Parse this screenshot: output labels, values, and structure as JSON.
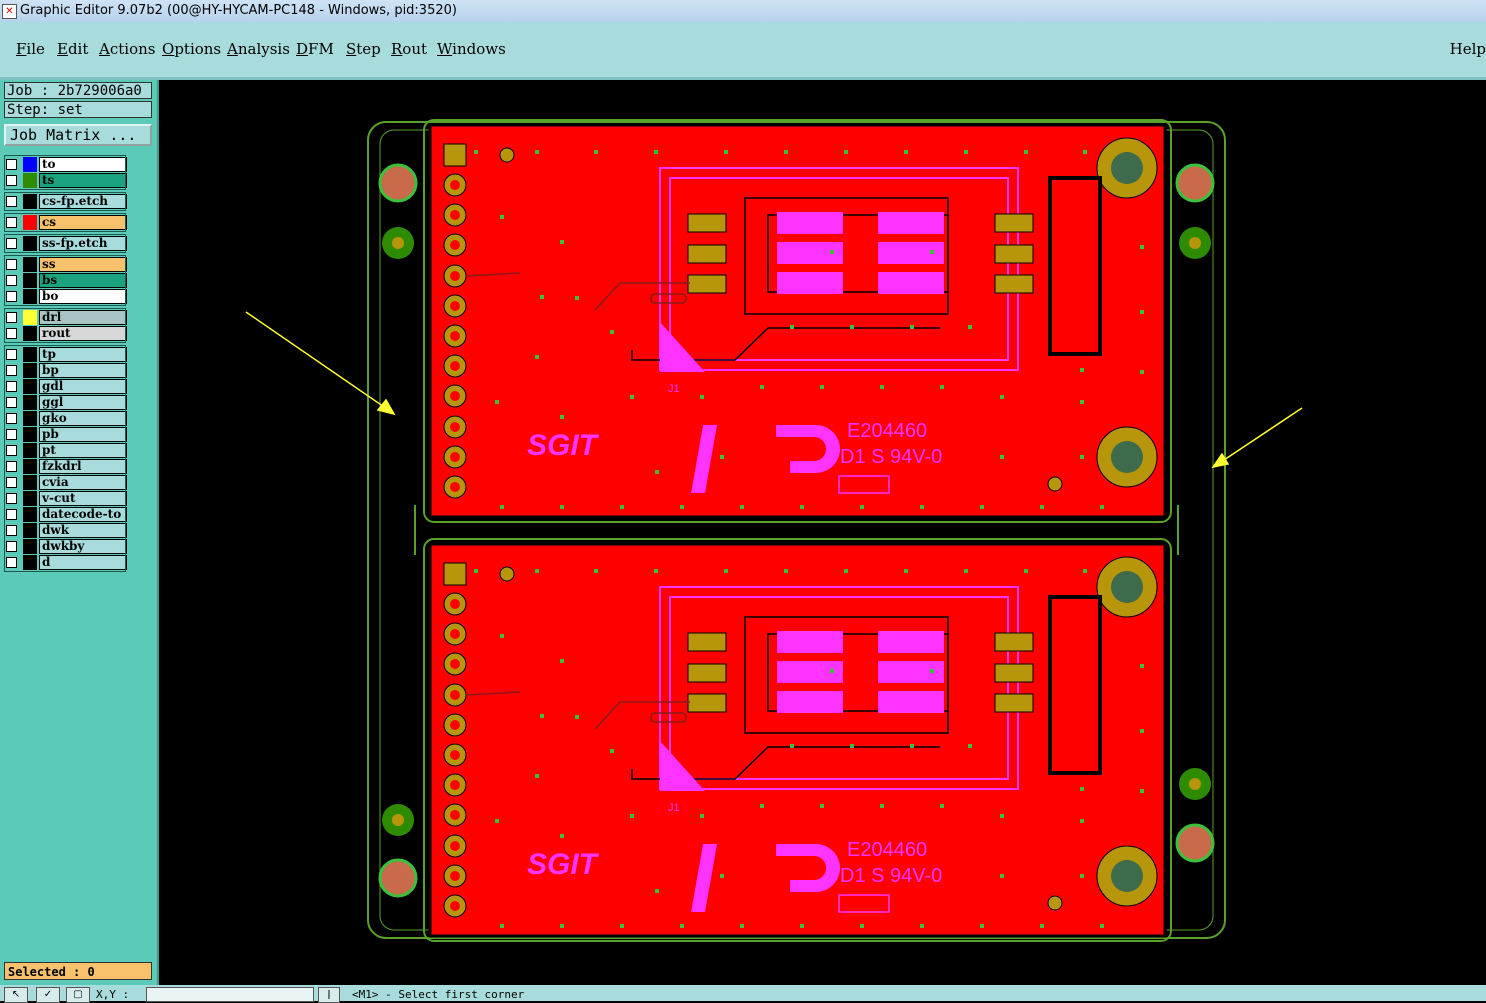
{
  "title_bar": {
    "title": "Graphic Editor 9.07b2 (00@HY-HYCAM-PC148 - Windows, pid:3520)"
  },
  "menu": {
    "items": [
      "File",
      "Edit",
      "Actions",
      "Options",
      "Analysis",
      "DFM",
      "Step",
      "Rout",
      "Windows"
    ],
    "help": "Help"
  },
  "job": {
    "job_label": "Job : 2b729006a0",
    "step_label": "Step: set",
    "matrix_button": "Job Matrix ..."
  },
  "layers": [
    {
      "name": "to",
      "swatch": "#0000ff",
      "bg": "#ffffff"
    },
    {
      "name": "ts",
      "swatch": "#2e8b00",
      "bg": "#1aa37e"
    },
    {
      "name": "cs-fp.etch",
      "swatch": "#000000",
      "bg": "#a8dcdc"
    },
    {
      "name": "cs",
      "swatch": "#ff0000",
      "bg": "#f7c26b"
    },
    {
      "name": "ss-fp.etch",
      "swatch": "#000000",
      "bg": "#a8dcdc"
    },
    {
      "name": "ss",
      "swatch": "#000000",
      "bg": "#f7c26b"
    },
    {
      "name": "bs",
      "swatch": "#000000",
      "bg": "#1aa37e"
    },
    {
      "name": "bo",
      "swatch": "#000000",
      "bg": "#ffffff"
    },
    {
      "name": "drl",
      "swatch": "#ffff33",
      "bg": "#a8c4c4"
    },
    {
      "name": "rout",
      "swatch": "#000000",
      "bg": "#d8d8d8"
    },
    {
      "name": "tp",
      "swatch": "#000000",
      "bg": "#a8dcdc"
    },
    {
      "name": "bp",
      "swatch": "#000000",
      "bg": "#a8dcdc"
    },
    {
      "name": "gdl",
      "swatch": "#000000",
      "bg": "#a8dcdc"
    },
    {
      "name": "ggl",
      "swatch": "#000000",
      "bg": "#a8dcdc"
    },
    {
      "name": "gko",
      "swatch": "#000000",
      "bg": "#a8dcdc"
    },
    {
      "name": "pb",
      "swatch": "#000000",
      "bg": "#a8dcdc"
    },
    {
      "name": "pt",
      "swatch": "#000000",
      "bg": "#a8dcdc"
    },
    {
      "name": "fzkdrl",
      "swatch": "#000000",
      "bg": "#a8dcdc"
    },
    {
      "name": "cvia",
      "swatch": "#000000",
      "bg": "#a8dcdc"
    },
    {
      "name": "v-cut",
      "swatch": "#000000",
      "bg": "#a8dcdc"
    },
    {
      "name": "datecode-to",
      "swatch": "#000000",
      "bg": "#a8dcdc"
    },
    {
      "name": "dwk",
      "swatch": "#000000",
      "bg": "#a8dcdc"
    },
    {
      "name": "dwkby",
      "swatch": "#000000",
      "bg": "#a8dcdc"
    },
    {
      "name": "d",
      "swatch": "#000000",
      "bg": "#a8dcdc"
    }
  ],
  "selected_label": "Selected : 0",
  "status": {
    "xy_label": "X,Y :",
    "prompt": "<M1> - Select first corner"
  },
  "board_text": {
    "logo": "SGIT",
    "ul_code": "E204460",
    "rating": "D1 S 94V-0",
    "connector": "J1"
  },
  "colors": {
    "board": "#ff0000",
    "outline": "#5aa12a",
    "pad": "#b8960b",
    "silk": "#ff33ff"
  }
}
